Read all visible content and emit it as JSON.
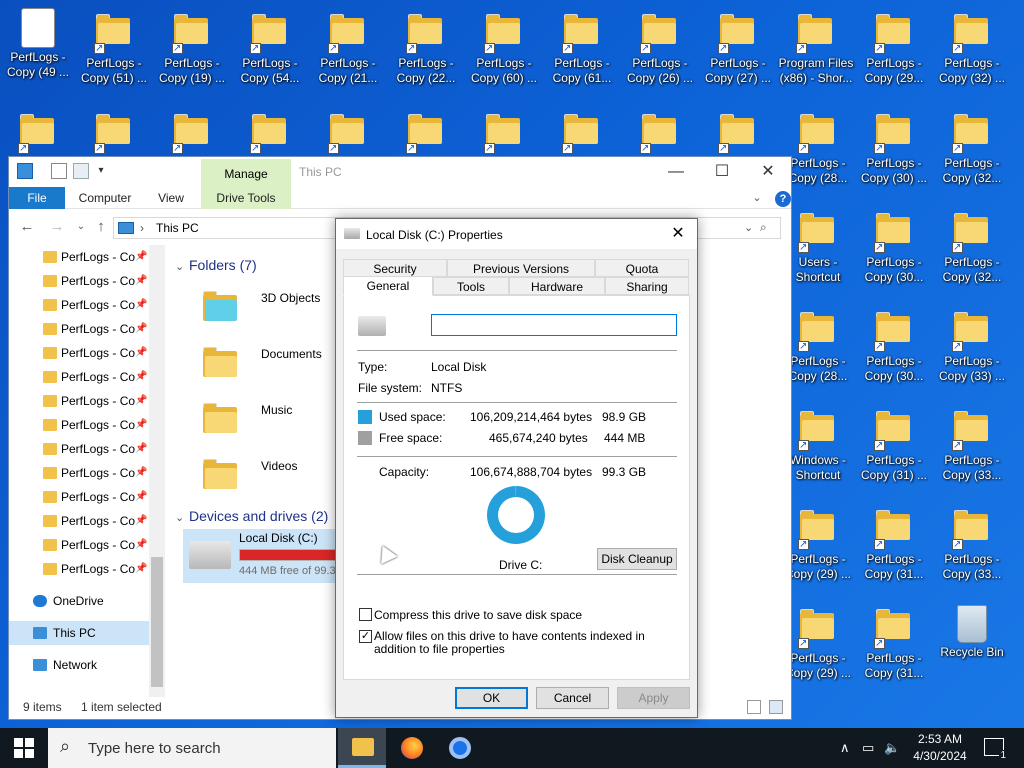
{
  "desktop": {
    "row1": [
      "PerfLogs - Copy (49 ...",
      "PerfLogs - Copy (51) ...",
      "PerfLogs - Copy (19) ...",
      "PerfLogs - Copy (54...",
      "PerfLogs - Copy (21...",
      "PerfLogs - Copy (22...",
      "PerfLogs - Copy (60) ...",
      "PerfLogs - Copy (61...",
      "PerfLogs - Copy (26) ...",
      "PerfLogs - Copy (27) ...",
      "Program Files (x86) - Shor...",
      "PerfLogs - Copy (29...",
      "PerfLogs - Copy (32) ..."
    ],
    "right_col1": [
      "PerfLogs - Copy (28...",
      "Users - Shortcut",
      "PerfLogs - Copy (28...",
      "Windows - Shortcut",
      "PerfLogs - Copy (29) ...",
      "PerfLogs - Copy (29) ..."
    ],
    "right_col2": [
      "PerfLogs - Copy (30) ...",
      "PerfLogs - Copy (30...",
      "PerfLogs - Copy (30...",
      "PerfLogs - Copy (31) ...",
      "PerfLogs - Copy (31...",
      "PerfLogs - Copy (31..."
    ],
    "right_col3": [
      "PerfLogs - Copy (32...",
      "PerfLogs - Copy (32...",
      "PerfLogs - Copy (33) ...",
      "PerfLogs - Copy (33...",
      "PerfLogs - Copy (33...",
      "Recycle Bin"
    ]
  },
  "explorer": {
    "manage_tab": "Manage",
    "title": "This PC",
    "ribbon_tabs": [
      "File",
      "Computer",
      "View",
      "Drive Tools"
    ],
    "address": "This PC",
    "nav_items": [
      "PerfLogs - Co",
      "PerfLogs - Co",
      "PerfLogs - Co",
      "PerfLogs - Co",
      "PerfLogs - Co",
      "PerfLogs - Co",
      "PerfLogs - Co",
      "PerfLogs - Co",
      "PerfLogs - Co",
      "PerfLogs - Co",
      "PerfLogs - Co",
      "PerfLogs - Co",
      "PerfLogs - Co",
      "PerfLogs - Co"
    ],
    "nav_onedrive": "OneDrive",
    "nav_thispc": "This PC",
    "nav_network": "Network",
    "folders_header": "Folders (7)",
    "folders": [
      "3D Objects",
      "Documents",
      "Music",
      "Videos"
    ],
    "drives_header": "Devices and drives (2)",
    "drive_name": "Local Disk (C:)",
    "drive_free": "444 MB free of 99.3",
    "status_items": "9 items",
    "status_selected": "1 item selected"
  },
  "dialog": {
    "title": "Local Disk (C:) Properties",
    "tabs_row1": [
      "Security",
      "Previous Versions",
      "Quota"
    ],
    "tabs_row2": [
      "General",
      "Tools",
      "Hardware",
      "Sharing"
    ],
    "name_value": "",
    "type_label": "Type:",
    "type_value": "Local Disk",
    "fs_label": "File system:",
    "fs_value": "NTFS",
    "used_label": "Used space:",
    "used_bytes": "106,209,214,464 bytes",
    "used_size": "98.9 GB",
    "free_label": "Free space:",
    "free_bytes": "465,674,240 bytes",
    "free_size": "444 MB",
    "cap_label": "Capacity:",
    "cap_bytes": "106,674,888,704 bytes",
    "cap_size": "99.3 GB",
    "used_fraction": 0.9956,
    "drive_label": "Drive C:",
    "cleanup_label": "Disk Cleanup",
    "compress_label": "Compress this drive to save disk space",
    "index_label": "Allow files on this drive to have contents indexed in addition to file properties",
    "ok": "OK",
    "cancel": "Cancel",
    "apply": "Apply",
    "colors": {
      "used": "#26a0da",
      "free": "#a0a0a0"
    }
  },
  "taskbar": {
    "search_placeholder": "Type here to search",
    "time": "2:53 AM",
    "date": "4/30/2024",
    "notification_count": "1"
  }
}
